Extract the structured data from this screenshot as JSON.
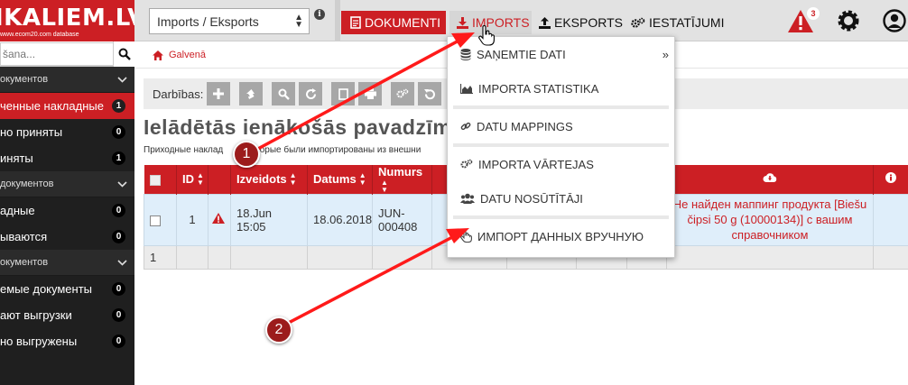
{
  "app": {
    "logo_title": "IKALIEM.LV",
    "logo_sub": "www.ecom20.com database"
  },
  "sidebar": {
    "search_placeholder": "šana...",
    "sections": [
      {
        "label": "окументов",
        "items": [
          {
            "label": "ченные накладные",
            "count": "1",
            "active": true
          },
          {
            "label": "но приняты",
            "count": "0",
            "active": false
          },
          {
            "label": "иняты",
            "count": "1",
            "active": false
          }
        ]
      },
      {
        "label": "документов",
        "items": [
          {
            "label": "адные",
            "count": "0",
            "active": false
          },
          {
            "label": "ываются",
            "count": "0",
            "active": false
          }
        ]
      },
      {
        "label": "окументов",
        "items": [
          {
            "label": "емые документы",
            "count": "0",
            "active": false
          },
          {
            "label": "ают выгрузки",
            "count": "0",
            "active": false
          },
          {
            "label": "но выгружены",
            "count": "0",
            "active": false
          }
        ]
      }
    ]
  },
  "topbar": {
    "select_value": "Imports / Eksports",
    "nav": {
      "dokumenti": "DOKUMENTI",
      "imports": "IMPORTS",
      "eksports": "EKSPORTS",
      "iestatijumi": "IESTATĪJUMI"
    },
    "alert_count": "3"
  },
  "breadcrumb": {
    "home": "Galvenā"
  },
  "toolbar": {
    "label": "Darbības:"
  },
  "page": {
    "title": "Ielādētās ienākošās pavadzīm",
    "desc_left": "Приходные наклад",
    "desc_right": "торые были импортированы из внешни"
  },
  "table": {
    "headers": {
      "id": "ID",
      "izveidots": "Izveidots",
      "datums": "Datums",
      "numurs": "Numurs"
    },
    "rows": [
      {
        "id": "1",
        "created": "18.Jun 15:05",
        "date": "18.06.2018",
        "number": "JUN-000408",
        "error": "Не найден маппинг продукта [Biešu čipsi 50 g (10000134)] с вашим справочником"
      }
    ],
    "footer_count": "1"
  },
  "dropdown": {
    "items": [
      {
        "label": "SAŅEMTIE DATI"
      },
      {
        "label": "IMPORTA STATISTIKA"
      },
      {
        "label": "DATU MAPPINGS"
      },
      {
        "label": "IMPORTA VĀRTEJAS"
      },
      {
        "label": "DATU NOSŪTĪTĀJI"
      },
      {
        "label": "ИМПОРТ ДАННЫХ ВРУЧНУЮ"
      }
    ]
  },
  "annotations": {
    "step1": "1",
    "step2": "2"
  },
  "colors": {
    "brand_red": "#cc1f24",
    "sidebar_bg": "#1f1f1f",
    "arrow_red": "#ff1a1a",
    "marker_red": "#9c1c1c",
    "row_highlight": "#dfeefa"
  }
}
